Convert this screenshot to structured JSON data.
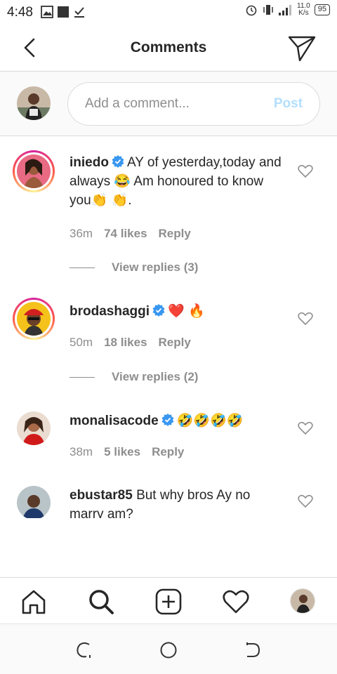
{
  "status_bar": {
    "time": "4:48",
    "network": "4G",
    "speed_value": "11.0",
    "speed_unit": "K/s",
    "battery": "95"
  },
  "header": {
    "title": "Comments"
  },
  "composer": {
    "placeholder": "Add a comment...",
    "post_label": "Post"
  },
  "comments": [
    {
      "username": "iniedo",
      "verified": true,
      "text_part1": "AY of yesterday,today and always",
      "emoji_1": "😂",
      "text_part2": "Am honoured to know you",
      "emoji_2": "👏 👏",
      "text_end": ".",
      "time": "36m",
      "likes": "74 likes",
      "reply": "Reply",
      "view_replies": "View replies (3)"
    },
    {
      "username": "brodashaggi",
      "verified": true,
      "emoji": "❤️ 🔥",
      "time": "50m",
      "likes": "18 likes",
      "reply": "Reply",
      "view_replies": "View replies (2)"
    },
    {
      "username": "monalisacode",
      "verified": true,
      "emoji": "🤣🤣🤣🤣",
      "time": "38m",
      "likes": "5 likes",
      "reply": "Reply"
    },
    {
      "username": "ebustar85",
      "verified": false,
      "text": "But why bros Ay no marry am?"
    }
  ],
  "icons": {
    "back": "chevron-left-icon",
    "send": "paper-plane-icon",
    "like": "heart-outline-icon",
    "home": "home-icon",
    "search": "search-icon",
    "new_post": "plus-square-icon",
    "activity": "heart-icon",
    "profile": "avatar"
  },
  "colors": {
    "post_disabled": "#b2dffc",
    "verified_blue": "#3897f0",
    "secondary_text": "#8e8e8e"
  }
}
